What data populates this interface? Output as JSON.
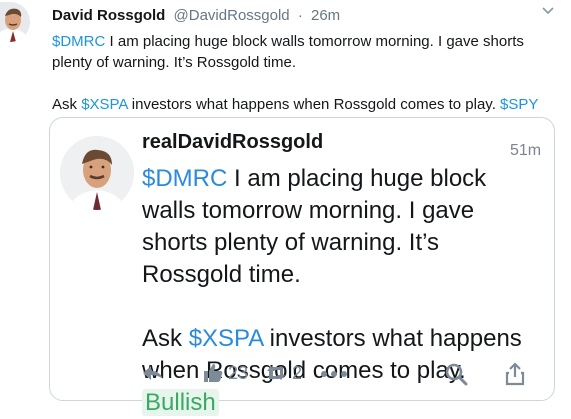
{
  "tweet": {
    "author_name": "David Rossgold",
    "author_handle": "@DavidRossgold",
    "separator": "·",
    "time": "26m",
    "line1_cashtag": "$DMRC",
    "line1_text": " I am placing huge block walls tomorrow morning. I gave shorts plenty of warning. It’s Rossgold time.",
    "line2_prefix": "Ask ",
    "line2_cashtag": "$XSPA",
    "line2_mid": " investors what happens when Rossgold comes to play. ",
    "line2_cashtag2": "$SPY"
  },
  "card": {
    "username": "realDavidRossgold",
    "time": "51m",
    "p1_cashtag": "$DMRC",
    "p1_text": " I am placing huge block walls tomorrow morning. I gave shorts plenty of warning. It’s Rossgold time.",
    "p2_prefix": "Ask ",
    "p2_cashtag": "$XSPA",
    "p2_text": " investors what happens when Rossgold comes to play. ",
    "sentiment": "Bullish",
    "likes": "23",
    "reshares": "2"
  },
  "icons": [
    "chevron-down-icon",
    "reply-icon",
    "thumbs-up-icon",
    "reshare-icon",
    "more-icon",
    "search-icon",
    "share-icon"
  ],
  "colors": {
    "cashtag": "#1b95e0",
    "bullish_text": "#3ba864",
    "bullish_bg": "#e6f6ec",
    "muted": "#657786"
  }
}
